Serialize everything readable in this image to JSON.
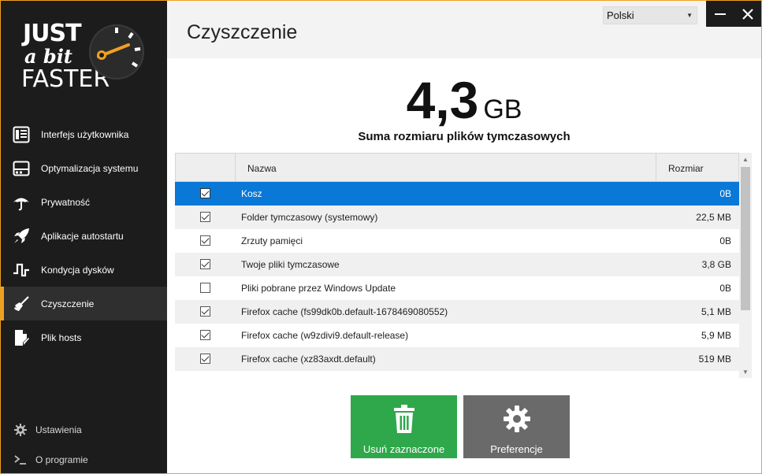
{
  "app": {
    "logo": {
      "line1": "JUST",
      "line2": "a bit",
      "line3": "FASTER"
    }
  },
  "sidebar": {
    "items": [
      {
        "label": "Interfejs użytkownika",
        "icon": "user-interface-icon"
      },
      {
        "label": "Optymalizacja systemu",
        "icon": "system-optimization-icon"
      },
      {
        "label": "Prywatność",
        "icon": "umbrella-icon"
      },
      {
        "label": "Aplikacje autostartu",
        "icon": "rocket-icon"
      },
      {
        "label": "Kondycja dysków",
        "icon": "disk-health-icon"
      },
      {
        "label": "Czyszczenie",
        "icon": "broom-icon",
        "active": true
      },
      {
        "label": "Plik hosts",
        "icon": "hosts-file-icon"
      }
    ],
    "bottom": [
      {
        "label": "Ustawienia",
        "icon": "gear-icon"
      },
      {
        "label": "O programie",
        "icon": "terminal-icon"
      }
    ]
  },
  "header": {
    "title": "Czyszczenie",
    "language": "Polski"
  },
  "summary": {
    "size": "4,3",
    "unit": "GB",
    "label": "Suma rozmiaru plików tymczasowych"
  },
  "table": {
    "columns": {
      "name": "Nazwa",
      "size": "Rozmiar"
    },
    "rows": [
      {
        "name": "Kosz",
        "size": "0B",
        "checked": true,
        "selected": true
      },
      {
        "name": "Folder tymczasowy (systemowy)",
        "size": "22,5 MB",
        "checked": true
      },
      {
        "name": "Zrzuty pamięci",
        "size": "0B",
        "checked": true
      },
      {
        "name": "Twoje pliki tymczasowe",
        "size": "3,8 GB",
        "checked": true
      },
      {
        "name": "Pliki pobrane przez Windows Update",
        "size": "0B",
        "checked": false
      },
      {
        "name": "Firefox cache (fs99dk0b.default-1678469080552)",
        "size": "5,1 MB",
        "checked": true
      },
      {
        "name": "Firefox cache (w9zdivi9.default-release)",
        "size": "5,9 MB",
        "checked": true
      },
      {
        "name": "Firefox cache (xz83axdt.default)",
        "size": "519 MB",
        "checked": true
      }
    ]
  },
  "actions": {
    "delete_label": "Usuń zaznaczone",
    "prefs_label": "Preferencje"
  },
  "colors": {
    "accent": "#f0a020",
    "sidebar_bg": "#1c1c1c",
    "selected_row": "#0a78d7",
    "delete_button": "#2ea84a",
    "prefs_button": "#6a6a6a"
  }
}
